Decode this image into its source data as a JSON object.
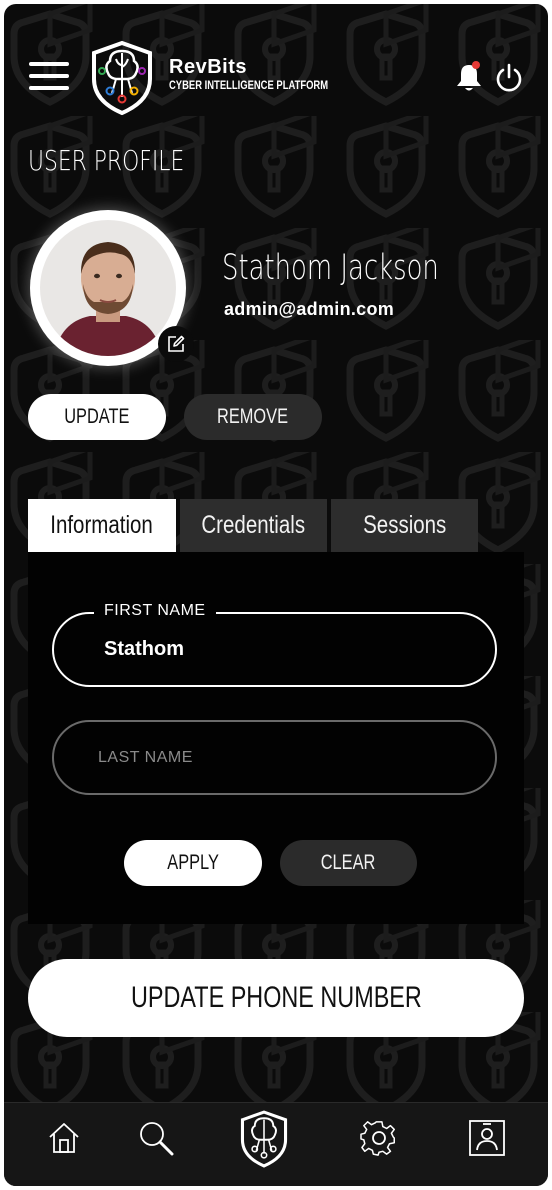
{
  "header": {
    "brand_name": "RevBits",
    "brand_tagline": "CYBER INTELLIGENCE PLATFORM"
  },
  "page_title": "USER PROFILE",
  "profile": {
    "name": "Stathom Jackson",
    "email": "admin@admin.com"
  },
  "photo_actions": {
    "update_label": "UPDATE",
    "remove_label": "REMOVE"
  },
  "tabs": [
    {
      "label": "Information",
      "active": true
    },
    {
      "label": "Credentials",
      "active": false
    },
    {
      "label": "Sessions",
      "active": false
    }
  ],
  "form": {
    "first_name_label": "FIRST NAME",
    "first_name_value": "Stathom",
    "last_name_placeholder": "LAST NAME",
    "apply_label": "APPLY",
    "clear_label": "CLEAR"
  },
  "update_phone_label": "UPDATE PHONE NUMBER",
  "bottom_nav": [
    {
      "icon": "home-icon"
    },
    {
      "icon": "search-icon"
    },
    {
      "icon": "brand-logo-icon"
    },
    {
      "icon": "settings-icon"
    },
    {
      "icon": "profile-icon"
    }
  ],
  "colors": {
    "background": "#0b0b0b",
    "pattern": "#1f1f1f",
    "notification_dot": "#e53935",
    "light_button": "#ffffff",
    "dark_button": "#2b2b2b"
  }
}
